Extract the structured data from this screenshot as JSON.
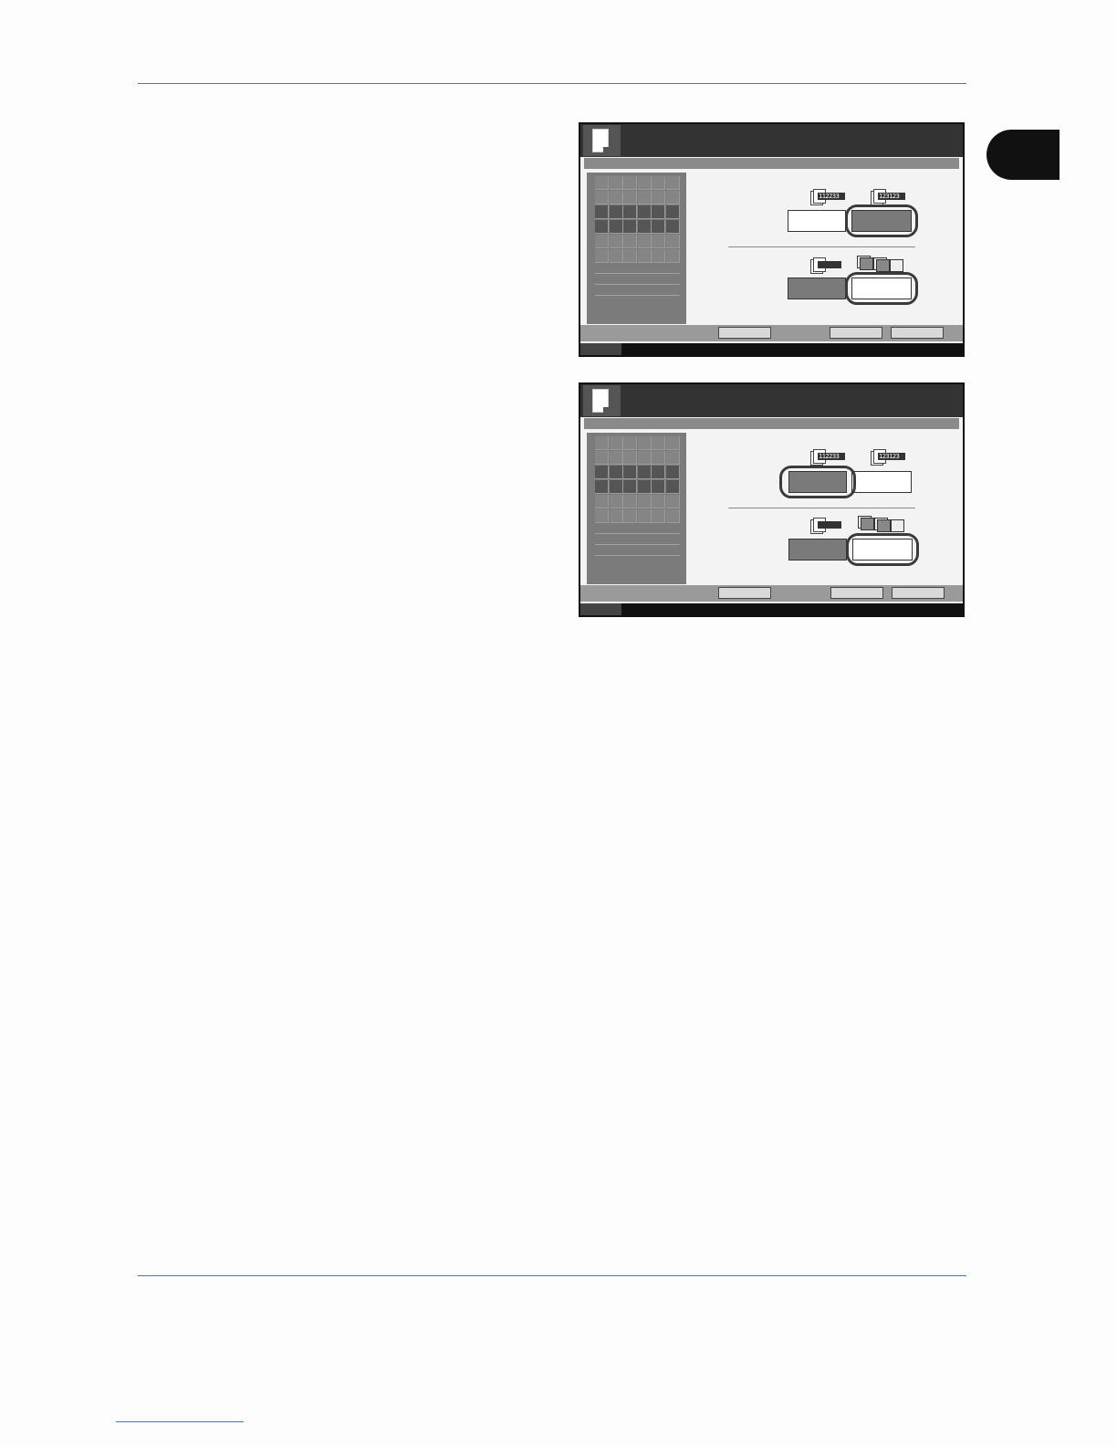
{
  "page": {
    "rule_color": "#3b7bbf",
    "chapter_tab_color": "#111111"
  },
  "panels": [
    {
      "icons": {
        "sort_icon_text": "112233",
        "group_icon_text": "123123"
      },
      "selected_option": "second",
      "highlighted_buttons": [
        "top-right",
        "bottom-right"
      ]
    },
    {
      "icons": {
        "sort_icon_text": "112233",
        "group_icon_text": "123123"
      },
      "selected_option": "first",
      "highlighted_buttons": [
        "top-left",
        "bottom-right"
      ]
    }
  ],
  "colors": {
    "titlebar": "#333333",
    "selected_button": "#7a7a7a",
    "unselected_button": "#ffffff",
    "highlight_ring": "#3a3a3a"
  }
}
